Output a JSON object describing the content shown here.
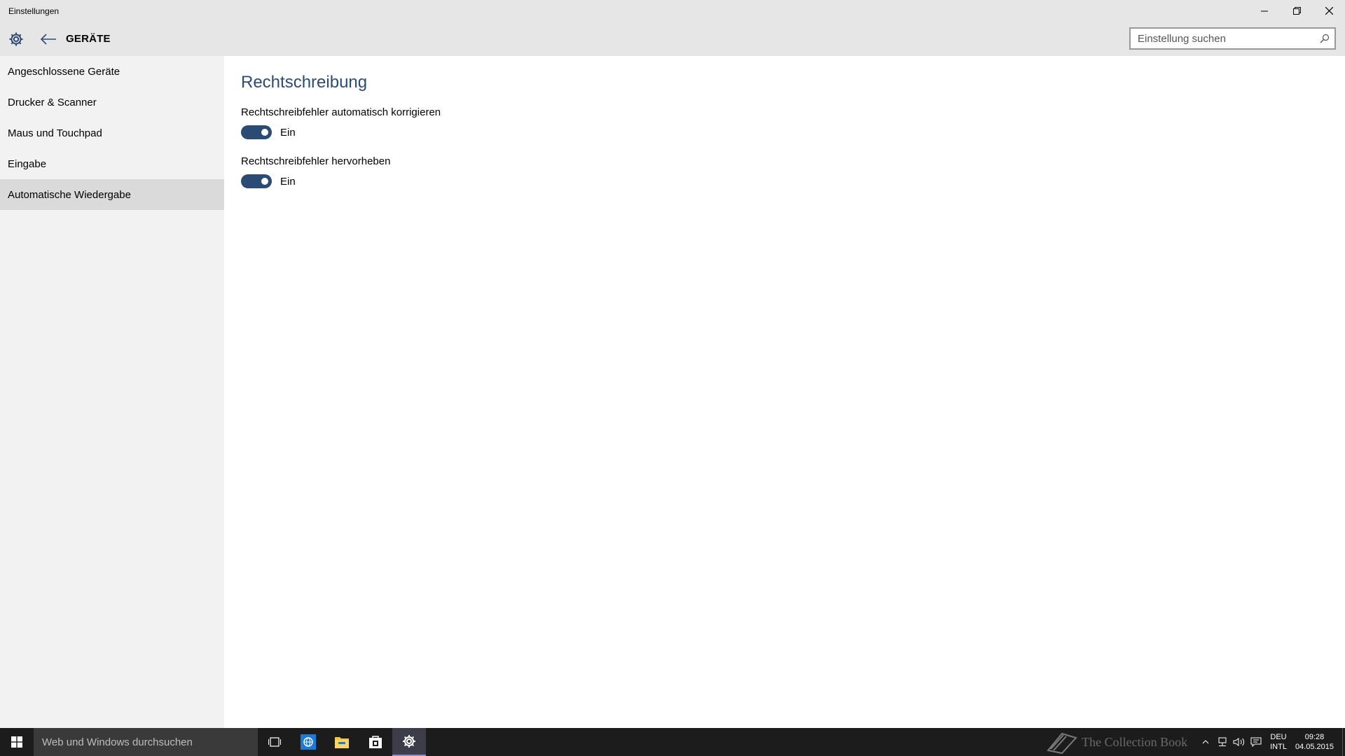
{
  "window": {
    "title": "Einstellungen",
    "controls": [
      "minimize-icon",
      "restore-icon",
      "close-icon"
    ]
  },
  "header": {
    "title": "GERÄTE",
    "search_placeholder": "Einstellung suchen"
  },
  "sidebar": {
    "items": [
      {
        "label": "Angeschlossene Geräte",
        "selected": false
      },
      {
        "label": "Drucker & Scanner",
        "selected": false
      },
      {
        "label": "Maus und Touchpad",
        "selected": false
      },
      {
        "label": "Eingabe",
        "selected": false
      },
      {
        "label": "Automatische Wiedergabe",
        "selected": true
      }
    ]
  },
  "content": {
    "section_title": "Rechtschreibung",
    "settings": [
      {
        "label": "Rechtschreibfehler automatisch korrigieren",
        "state": "Ein",
        "on": true
      },
      {
        "label": "Rechtschreibfehler hervorheben",
        "state": "Ein",
        "on": true
      }
    ]
  },
  "taskbar": {
    "search_placeholder": "Web und Windows durchsuchen",
    "apps": [
      "task-view-icon",
      "browser-icon",
      "file-explorer-icon",
      "store-icon",
      "settings-icon"
    ],
    "watermark": "The Collection Book",
    "language": {
      "line1": "DEU",
      "line2": "INTL"
    },
    "clock": {
      "time": "09:28",
      "date": "04.05.2015"
    }
  },
  "colors": {
    "accent": "#2b4b74",
    "titlebar_bg": "#e6e6e6",
    "sidebar_bg": "#f2f2f2",
    "sidebar_selected_bg": "#dadada",
    "taskbar_bg": "#1c1c1c"
  }
}
